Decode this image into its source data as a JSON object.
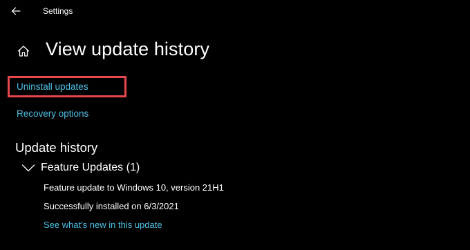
{
  "window": {
    "title": "Settings"
  },
  "icons": {
    "back": "back-arrow-icon",
    "home": "home-icon",
    "expand": "chevron-down-icon"
  },
  "colors": {
    "background": "#000000",
    "text": "#ffffff",
    "link": "#4cc2e6",
    "highlight": "#e8474e"
  },
  "page": {
    "title": "View update history"
  },
  "links": {
    "uninstall": "Uninstall updates",
    "recovery": "Recovery options"
  },
  "history": {
    "heading": "Update history",
    "groups": [
      {
        "label": "Feature Updates (1)",
        "expanded": true,
        "entries": [
          {
            "name": "Feature update to Windows 10, version 21H1",
            "status": "Successfully installed on 6/3/2021",
            "link": "See what's new in this update"
          }
        ]
      }
    ]
  }
}
